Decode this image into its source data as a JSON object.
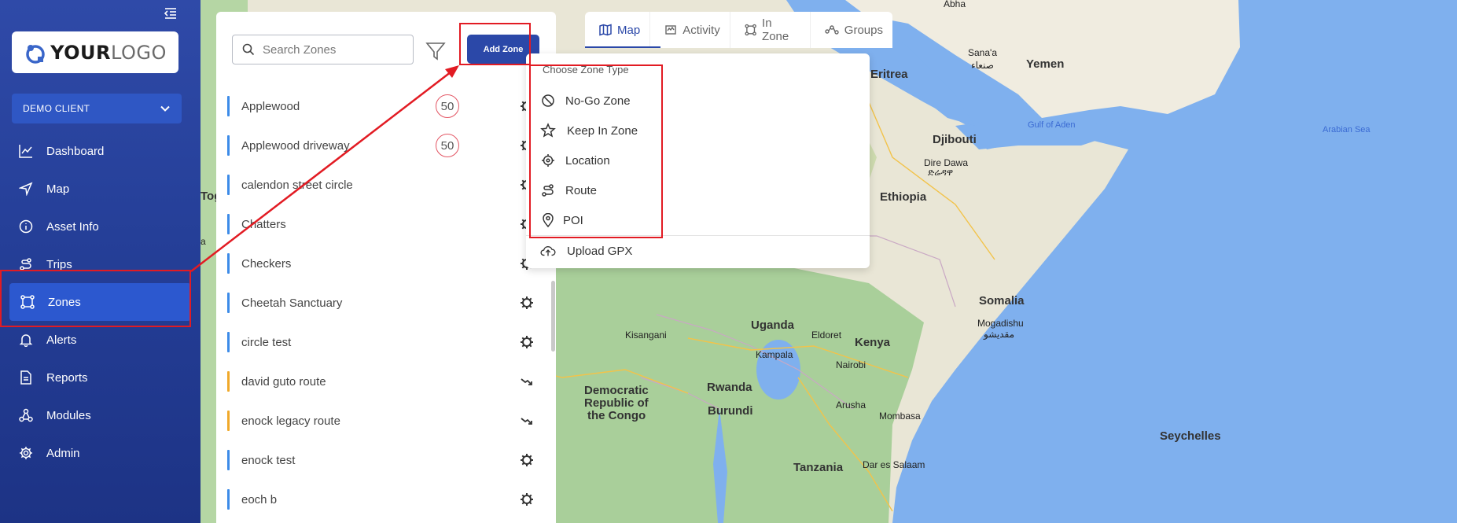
{
  "sidebar": {
    "logo": {
      "part1": "YOUR",
      "part2": "LOGO"
    },
    "client": "DEMO CLIENT",
    "items": [
      {
        "label": "Dashboard",
        "icon": "chart-line-icon"
      },
      {
        "label": "Map",
        "icon": "navigation-arrow-icon"
      },
      {
        "label": "Asset Info",
        "icon": "info-circle-icon"
      },
      {
        "label": "Trips",
        "icon": "route-icon"
      },
      {
        "label": "Zones",
        "icon": "zones-icon",
        "active": true
      },
      {
        "label": "Alerts",
        "icon": "bell-icon"
      },
      {
        "label": "Reports",
        "icon": "document-icon"
      },
      {
        "label": "Modules",
        "icon": "modules-icon"
      },
      {
        "label": "Admin",
        "icon": "gear-icon"
      }
    ]
  },
  "zones_panel": {
    "search_placeholder": "Search Zones",
    "add_button": "Add Zone",
    "zones": [
      {
        "name": "Applewood",
        "count": "50",
        "color": "#3c8be8",
        "action": "gear-icon"
      },
      {
        "name": "Applewood driveway",
        "count": "50",
        "color": "#3c8be8",
        "action": "gear-icon"
      },
      {
        "name": "calendon street circle",
        "count": "",
        "color": "#3c8be8",
        "action": "gear-icon"
      },
      {
        "name": "Chatters",
        "count": "",
        "color": "#3c8be8",
        "action": "gear-icon"
      },
      {
        "name": "Checkers",
        "count": "",
        "color": "#3c8be8",
        "action": "gear-icon"
      },
      {
        "name": "Cheetah Sanctuary",
        "count": "",
        "color": "#3c8be8",
        "action": "gear-icon"
      },
      {
        "name": "circle test",
        "count": "",
        "color": "#3c8be8",
        "action": "gear-icon"
      },
      {
        "name": "david guto route",
        "count": "",
        "color": "#f0a92a",
        "action": "trend-route-icon"
      },
      {
        "name": "enock legacy route",
        "count": "",
        "color": "#f0a92a",
        "action": "trend-route-icon"
      },
      {
        "name": "enock test",
        "count": "",
        "color": "#3c8be8",
        "action": "gear-icon"
      },
      {
        "name": "eoch b",
        "count": "",
        "color": "#3c8be8",
        "action": "gear-icon"
      }
    ]
  },
  "tabs": [
    {
      "label": "Map",
      "active": true
    },
    {
      "label": "Activity"
    },
    {
      "label": "In Zone"
    },
    {
      "label": "Groups"
    }
  ],
  "zone_menu": {
    "title": "Choose Zone Type",
    "items": [
      {
        "label": "No-Go Zone",
        "icon": "no-entry-icon"
      },
      {
        "label": "Keep In Zone",
        "icon": "star-icon"
      },
      {
        "label": "Location",
        "icon": "location-target-icon"
      },
      {
        "label": "Route",
        "icon": "route-icon"
      },
      {
        "label": "POI",
        "icon": "map-pin-icon"
      }
    ],
    "upload": {
      "label": "Upload GPX",
      "icon": "cloud-upload-icon"
    }
  },
  "map": {
    "labels": [
      {
        "text": "Abha",
        "kind": "city"
      },
      {
        "text": "Sana'a",
        "kind": "city"
      },
      {
        "text": "صنعاء",
        "kind": "city"
      },
      {
        "text": "Yemen",
        "kind": "country"
      },
      {
        "text": "Eritrea",
        "kind": "country"
      },
      {
        "text": "Gulf of Aden",
        "kind": "sea"
      },
      {
        "text": "Arabian Sea",
        "kind": "sea"
      },
      {
        "text": "Djibouti",
        "kind": "country"
      },
      {
        "text": "Dire Dawa",
        "kind": "city"
      },
      {
        "text": "ድሬዳዋ",
        "kind": "city"
      },
      {
        "text": "Ethiopia",
        "kind": "country"
      },
      {
        "text": "Somalia",
        "kind": "country"
      },
      {
        "text": "Mogadishu",
        "kind": "city"
      },
      {
        "text": "مقديشو",
        "kind": "city"
      },
      {
        "text": "Uganda",
        "kind": "country"
      },
      {
        "text": "Kisangani",
        "kind": "city"
      },
      {
        "text": "Eldoret",
        "kind": "city"
      },
      {
        "text": "Kampala",
        "kind": "city"
      },
      {
        "text": "Kenya",
        "kind": "country"
      },
      {
        "text": "Nairobi",
        "kind": "city"
      },
      {
        "text": "Democratic",
        "kind": "country"
      },
      {
        "text": "Republic of",
        "kind": "country"
      },
      {
        "text": "the Congo",
        "kind": "country"
      },
      {
        "text": "Rwanda",
        "kind": "country"
      },
      {
        "text": "Burundi",
        "kind": "country"
      },
      {
        "text": "Arusha",
        "kind": "city"
      },
      {
        "text": "Mombasa",
        "kind": "city"
      },
      {
        "text": "Tanzania",
        "kind": "country"
      },
      {
        "text": "Dar es Salaam",
        "kind": "city"
      },
      {
        "text": "Seychelles",
        "kind": "country"
      },
      {
        "text": "Tog",
        "kind": "country"
      },
      {
        "text": "a",
        "kind": "city"
      }
    ]
  },
  "colors": {
    "sidebar": "#253f98",
    "accent": "#2b48a8",
    "active_nav": "#2c58cf",
    "annotation": "#e21b23",
    "sea": "#7fb0ee",
    "land": "#dfe7c9"
  }
}
